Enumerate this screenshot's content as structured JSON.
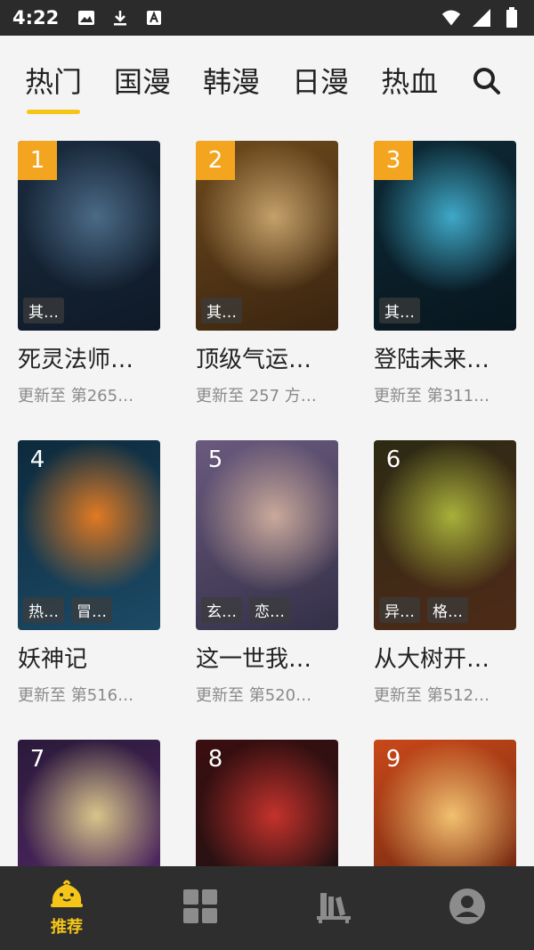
{
  "statusbar": {
    "time": "4:22"
  },
  "tabs": [
    {
      "label": "热门",
      "active": true
    },
    {
      "label": "国漫"
    },
    {
      "label": "韩漫"
    },
    {
      "label": "日漫"
    },
    {
      "label": "热血"
    }
  ],
  "comics": [
    {
      "rank": "1",
      "title": "死灵法师…",
      "update": "更新至 第265…",
      "tags": [
        "其…"
      ],
      "colors": [
        "#1a2b3e",
        "#4b6a86",
        "#0f1a28"
      ]
    },
    {
      "rank": "2",
      "title": "顶级气运…",
      "update": "更新至 257 方…",
      "tags": [
        "其…"
      ],
      "colors": [
        "#6e4a1c",
        "#c4a06a",
        "#3a2410"
      ]
    },
    {
      "rank": "3",
      "title": "登陆未来…",
      "update": "更新至 第311…",
      "tags": [
        "其…"
      ],
      "colors": [
        "#0d2a36",
        "#3fa8c7",
        "#08161f"
      ]
    },
    {
      "rank": "4",
      "title": "妖神记",
      "update": "更新至 第516…",
      "tags": [
        "热…",
        "冒…"
      ],
      "colors": [
        "#0c2a3c",
        "#e07a22",
        "#1d4a66"
      ]
    },
    {
      "rank": "5",
      "title": "这一世我…",
      "update": "更新至 第520…",
      "tags": [
        "玄…",
        "恋…"
      ],
      "colors": [
        "#6a5a7e",
        "#c9a99a",
        "#343048"
      ]
    },
    {
      "rank": "6",
      "title": "从大树开…",
      "update": "更新至 第512…",
      "tags": [
        "异…",
        "格…"
      ],
      "colors": [
        "#2c2a14",
        "#a8b03a",
        "#4e2a18"
      ]
    },
    {
      "rank": "7",
      "title": "",
      "update": "",
      "tags": [],
      "colors": [
        "#2a1a3a",
        "#d8c48a",
        "#5a2a6e"
      ]
    },
    {
      "rank": "8",
      "title": "",
      "update": "",
      "tags": [],
      "colors": [
        "#3a0e10",
        "#c4322c",
        "#1a1414"
      ]
    },
    {
      "rank": "9",
      "title": "",
      "update": "",
      "tags": [],
      "colors": [
        "#c84818",
        "#f1c070",
        "#5a2010"
      ]
    }
  ],
  "nav": {
    "recommend_label": "推荐"
  }
}
